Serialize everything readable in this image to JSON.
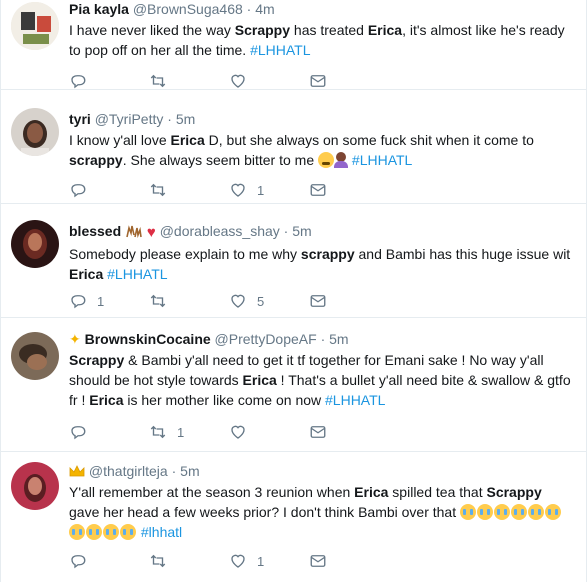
{
  "tweets": [
    {
      "name": "Pia kayla",
      "handle": "@BrownSuga468",
      "time": "4m",
      "segments": [
        {
          "t": "I have never liked the way "
        },
        {
          "t": "Scrappy",
          "b": true
        },
        {
          "t": " has treated "
        },
        {
          "t": "Erica",
          "b": true
        },
        {
          "t": ", it's almost like he's ready to pop off on her all the time. "
        },
        {
          "t": "#LHHATL",
          "h": true
        }
      ],
      "reply_count": "",
      "retweet_count": "",
      "like_count": ""
    },
    {
      "name": "tyri",
      "handle": "@TyriPetty",
      "time": "5m",
      "segments": [
        {
          "t": "I know y'all love "
        },
        {
          "t": "Erica",
          "b": true
        },
        {
          "t": " D, but she always on some fuck shit when it come to "
        },
        {
          "t": "scrappy",
          "b": true
        },
        {
          "t": ". She always seem bitter to me "
        },
        {
          "e": "persevere"
        },
        {
          "e": "woman"
        },
        {
          "t": " "
        },
        {
          "t": "#LHHATL",
          "h": true
        }
      ],
      "reply_count": "",
      "retweet_count": "",
      "like_count": "1"
    },
    {
      "name": "blessed",
      "handle": "@dorableass_shay",
      "time": "5m",
      "segments": [
        {
          "t": "Somebody please  explain to me why "
        },
        {
          "t": "scrappy",
          "b": true
        },
        {
          "t": " and Bambi has this huge issue wit "
        },
        {
          "t": "Erica",
          "b": true
        },
        {
          "t": " "
        },
        {
          "t": "#LHHATL",
          "h": true
        }
      ],
      "reply_count": "1",
      "retweet_count": "",
      "like_count": "5"
    },
    {
      "name": "BrownskinCocaine",
      "handle": "@PrettyDopeAF",
      "time": "5m",
      "segments": [
        {
          "t": "Scrappy",
          "b": true
        },
        {
          "t": " & Bambi y'all need to get it tf together for Emani sake ! No way y'all should be hot style towards "
        },
        {
          "t": "Erica",
          "b": true
        },
        {
          "t": " ! That's a bullet y'all need bite & swallow & gtfo fr ! "
        },
        {
          "t": "Erica",
          "b": true
        },
        {
          "t": " is her mother like come on now "
        },
        {
          "t": "#LHHATL",
          "h": true
        }
      ],
      "reply_count": "",
      "retweet_count": "1",
      "like_count": ""
    },
    {
      "name": "",
      "handle": "@thatgirlteja",
      "time": "5m",
      "segments": [
        {
          "t": "Y'all remember at the season 3 reunion when "
        },
        {
          "t": "Erica",
          "b": true
        },
        {
          "t": " spilled tea that "
        },
        {
          "t": "Scrappy",
          "b": true
        },
        {
          "t": " gave her head a few weeks prior? I don't think Bambi over that "
        },
        {
          "e": "cry"
        },
        {
          "e": "cry"
        },
        {
          "e": "cry"
        },
        {
          "e": "cry"
        },
        {
          "e": "cry"
        },
        {
          "e": "cry"
        },
        {
          "t": " "
        },
        {
          "e": "cry"
        },
        {
          "e": "cry"
        },
        {
          "e": "cry"
        },
        {
          "e": "cry"
        },
        {
          "t": " "
        },
        {
          "t": "#lhhatl",
          "h": true
        }
      ],
      "reply_count": "",
      "retweet_count": "",
      "like_count": "1"
    }
  ],
  "icons": {
    "reply": "reply-icon",
    "retweet": "retweet-icon",
    "like": "heart-icon",
    "dm": "envelope-icon"
  },
  "colors": {
    "hashtag": "#1b95e0",
    "muted": "#657786",
    "divider": "#e6ecf0"
  }
}
